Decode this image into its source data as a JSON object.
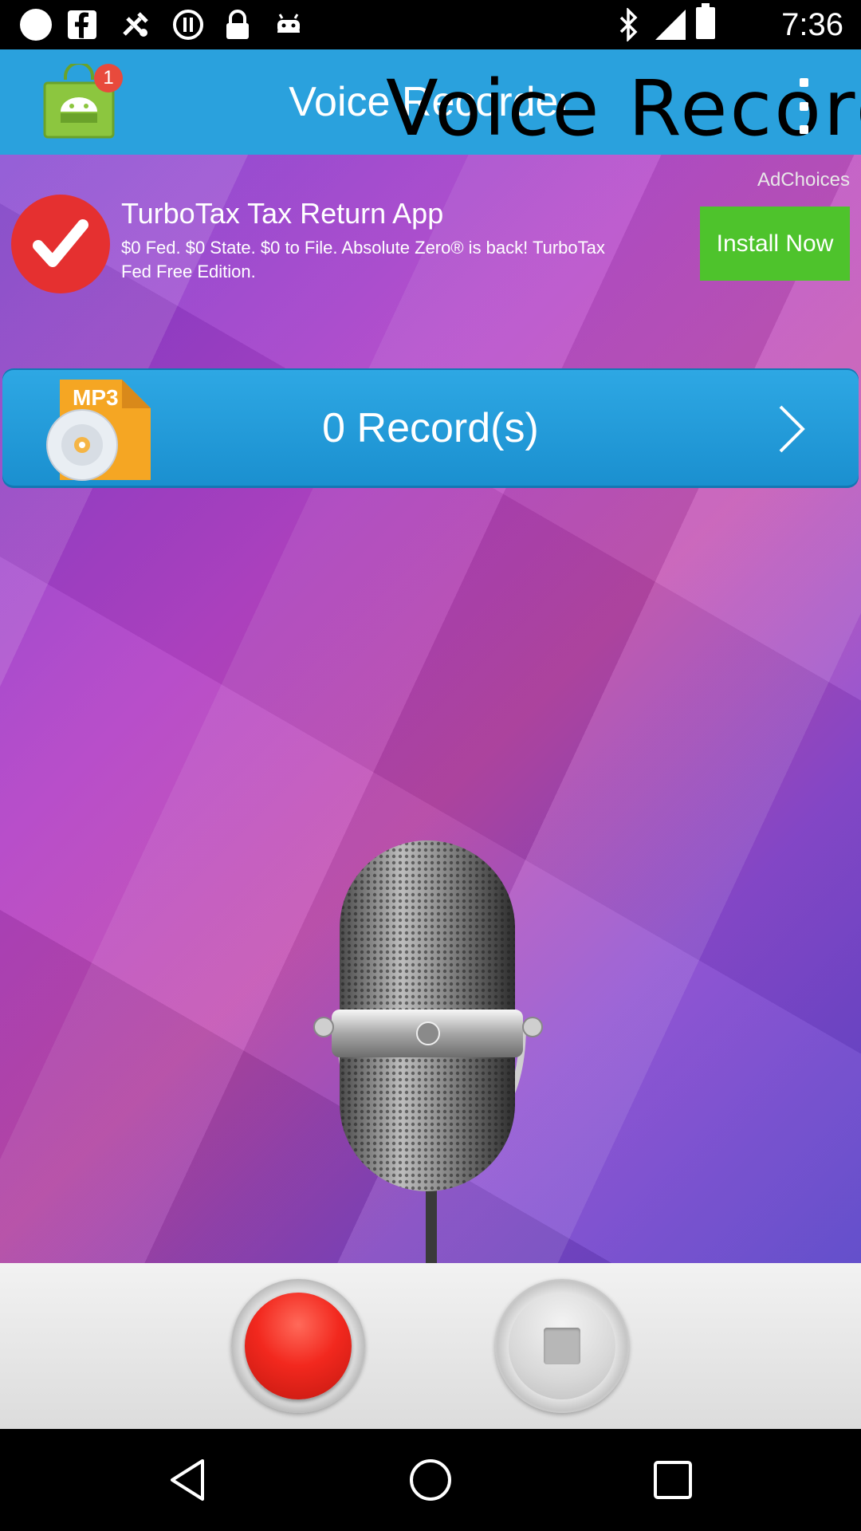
{
  "status_bar": {
    "time": "7:36",
    "icons": [
      "circle-icon",
      "facebook-icon",
      "fake-gps-icon",
      "data-saver-icon",
      "lock-icon",
      "android-icon",
      "bluetooth-icon",
      "signal-icon",
      "battery-icon"
    ]
  },
  "app_bar": {
    "title": "Voice Recorder",
    "title_overlay": "Voice Recorder",
    "app_icon": "android-store-icon",
    "badge_count": "1",
    "menu_icon": "more-vert-icon",
    "color": "#2aa1dd"
  },
  "ad": {
    "adchoices": "AdChoices",
    "title": "TurboTax Tax Return App",
    "description": "$0 Fed. $0 State. $0 to File. Absolute Zero® is back! TurboTax Fed Free Edition.",
    "cta": "Install Now",
    "icon": "checkmark-icon",
    "cta_color": "#4ec32c"
  },
  "records": {
    "label": "0 Record(s)",
    "file_icon": "mp3-file-icon",
    "chevron": "chevron-right-icon"
  },
  "microphone": {
    "icon": "microphone-icon"
  },
  "controls": {
    "record_icon": "record-icon",
    "stop_icon": "stop-icon",
    "record_color": "#f2281e"
  },
  "nav_bar": {
    "back_icon": "back-icon",
    "home_icon": "home-icon",
    "recents_icon": "recents-icon"
  }
}
